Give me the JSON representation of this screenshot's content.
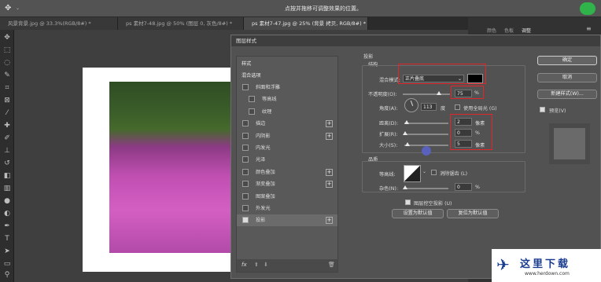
{
  "window": {
    "title": "点按并拖移可调整效果的位置。"
  },
  "doc_tabs": [
    {
      "label": "风景背景.jpg @ 33.3%(RGB/8#) *"
    },
    {
      "label": "ps 素材7-48.jpg @ 50% (图层 0, 灰色/8#) *"
    },
    {
      "label": "ps 素材7-47.jpg @ 25% (背景 拷贝, RGB/8#) *"
    }
  ],
  "right_panel": {
    "tabs": [
      "颜色",
      "色板",
      "调整"
    ]
  },
  "dialog": {
    "title": "图层样式",
    "styles_header": "样式",
    "blend_options": "混合选项",
    "styles": [
      {
        "label": "斜面和浮雕",
        "checked": false,
        "plus": false,
        "sub": false
      },
      {
        "label": "等高线",
        "checked": false,
        "plus": false,
        "sub": true
      },
      {
        "label": "纹理",
        "checked": false,
        "plus": false,
        "sub": true
      },
      {
        "label": "描边",
        "checked": false,
        "plus": true,
        "sub": false
      },
      {
        "label": "内阴影",
        "checked": false,
        "plus": true,
        "sub": false
      },
      {
        "label": "内发光",
        "checked": false,
        "plus": false,
        "sub": false
      },
      {
        "label": "光泽",
        "checked": false,
        "plus": false,
        "sub": false
      },
      {
        "label": "颜色叠加",
        "checked": false,
        "plus": true,
        "sub": false
      },
      {
        "label": "渐变叠加",
        "checked": false,
        "plus": true,
        "sub": false
      },
      {
        "label": "图案叠加",
        "checked": false,
        "plus": false,
        "sub": false
      },
      {
        "label": "外发光",
        "checked": false,
        "plus": false,
        "sub": false
      },
      {
        "label": "投影",
        "checked": true,
        "plus": true,
        "sub": false
      }
    ],
    "fx_label": "fx",
    "section_title": "投影",
    "structure_label": "结构",
    "blend_mode_label": "混合模式:",
    "blend_mode_value": "正片叠底",
    "shadow_color": "#000000",
    "opacity_label": "不透明度(O):",
    "opacity_value": "75",
    "percent": "%",
    "angle_label": "角度(A):",
    "angle_value": "113",
    "degree": "度",
    "global_light_label": "使用全局光 (G)",
    "distance_label": "距离(D):",
    "distance_value": "2",
    "spread_label": "扩展(R):",
    "spread_value": "0",
    "size_label": "大小(S):",
    "size_value": "5",
    "pixel": "像素",
    "quality_label": "品质",
    "contour_label": "等高线:",
    "antialias_label": "消除锯齿 (L)",
    "noise_label": "杂色(N):",
    "noise_value": "0",
    "knockout_label": "图层挖空投影 (U)",
    "set_default": "设置为默认值",
    "reset_default": "复位为默认值",
    "ok": "确定",
    "cancel": "取消",
    "new_style": "新建样式(W)...",
    "preview_label": "预览(V)"
  },
  "watermark": {
    "brand": "这里下载",
    "url": "www.herdown.com"
  }
}
